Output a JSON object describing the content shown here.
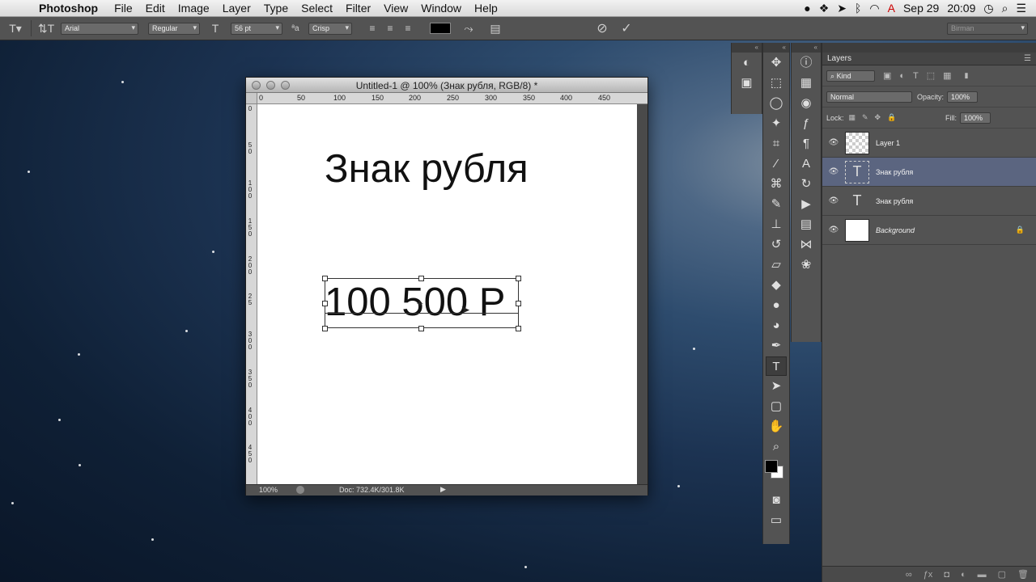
{
  "menubar": {
    "app_name": "Photoshop",
    "items": [
      "File",
      "Edit",
      "Image",
      "Layer",
      "Type",
      "Select",
      "Filter",
      "View",
      "Window",
      "Help"
    ],
    "date": "Sep 29",
    "time": "20:09"
  },
  "options": {
    "font_family": "Arial",
    "font_style": "Regular",
    "font_size": "56 pt",
    "antialias_label": "ªa",
    "antialias": "Crisp",
    "workspace": "Birman"
  },
  "document": {
    "title": "Untitled-1 @ 100% (Знак рубля, RGB/8) *",
    "ruler_top": [
      "0",
      "50",
      "100",
      "150",
      "200",
      "250",
      "300",
      "350",
      "400",
      "450"
    ],
    "ruler_left": [
      "0",
      "5 0",
      "1 0 0",
      "1 5 0",
      "2 0 0",
      "2 5",
      "3 0 0",
      "3 5 0",
      "4 0 0",
      "4 5 0"
    ],
    "heading_text": "Знак рубля",
    "amount_text": "100 500 Р",
    "zoom": "100%",
    "doc_info": "Doc: 732.4K/301.8K"
  },
  "layers": {
    "panel_title": "Layers",
    "kind_filter": "Kind",
    "blend_mode": "Normal",
    "opacity_label": "Opacity:",
    "opacity": "100%",
    "lock_label": "Lock:",
    "fill_label": "Fill:",
    "fill": "100%",
    "items": [
      {
        "name": "Layer 1"
      },
      {
        "name": "Знак рубля"
      },
      {
        "name": "Знак рубля"
      },
      {
        "name": "Background"
      }
    ]
  },
  "colors": {
    "foreground": "#000000",
    "background": "#ffffff",
    "selected_layer": "#5b6580"
  }
}
